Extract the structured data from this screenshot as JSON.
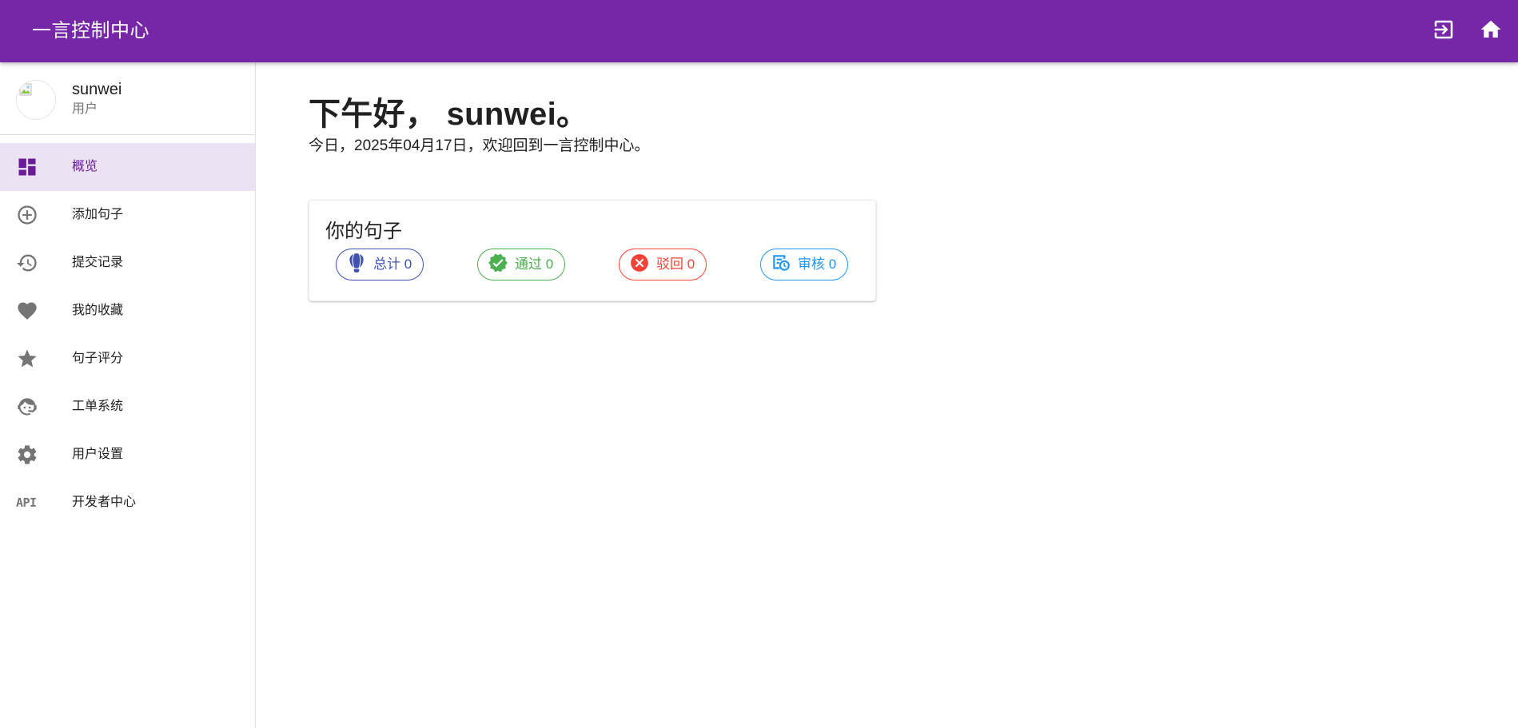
{
  "appbar": {
    "title": "一言控制中心",
    "color": "#7627a8",
    "actions": [
      {
        "icon": "exit-icon"
      },
      {
        "icon": "home-icon"
      }
    ]
  },
  "profile": {
    "name": "sunwei",
    "role": "用户",
    "avatar_icon": "broken-image-icon"
  },
  "nav": {
    "items": [
      {
        "label": "概览",
        "icon": "dashboard-icon",
        "active": true
      },
      {
        "label": "添加句子",
        "icon": "plus-circle-icon"
      },
      {
        "label": "提交记录",
        "icon": "history-icon"
      },
      {
        "label": "我的收藏",
        "icon": "heart-icon"
      },
      {
        "label": "句子评分",
        "icon": "star-icon"
      },
      {
        "label": "工单系统",
        "icon": "face-agent-icon"
      },
      {
        "label": "用户设置",
        "icon": "gear-icon"
      },
      {
        "label": "开发者中心",
        "icon": "api-icon",
        "icon_text": "API"
      }
    ]
  },
  "main": {
    "greeting": "下午好， sunwei。",
    "subtitle": "今日，2025年04月17日，欢迎回到一言控制中心。",
    "card": {
      "title": "你的句子",
      "chips": [
        {
          "label": "总计 0",
          "icon": "hot-air-balloon-icon",
          "color": "#3f51b5"
        },
        {
          "label": "通过 0",
          "icon": "check-decagram-icon",
          "color": "#4caf50"
        },
        {
          "label": "驳回 0",
          "icon": "close-circle-icon",
          "color": "#f44336"
        },
        {
          "label": "审核 0",
          "icon": "file-clock-icon",
          "color": "#2196f3"
        }
      ]
    }
  }
}
